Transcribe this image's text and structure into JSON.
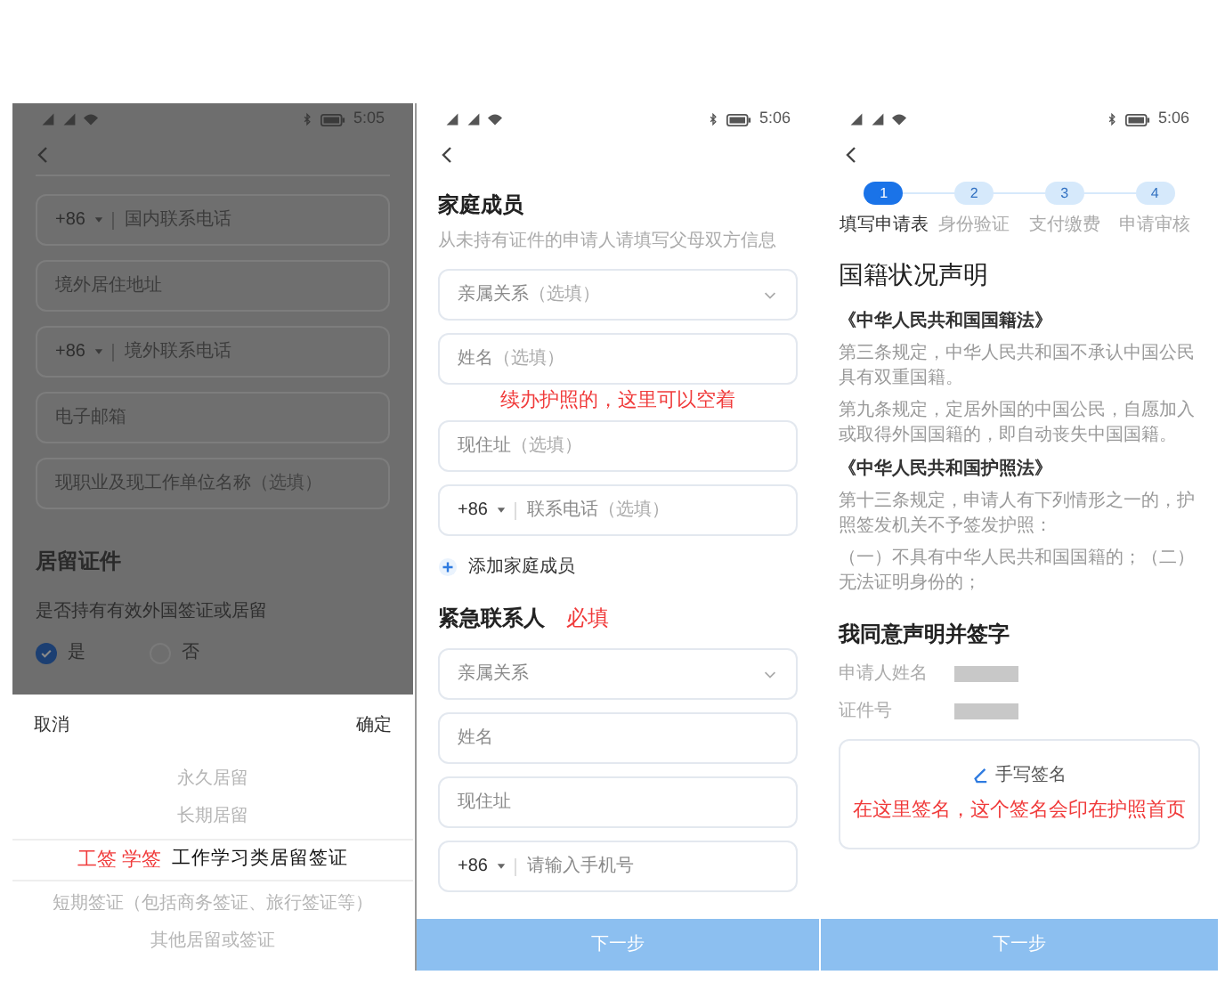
{
  "left_screen": {
    "status_time": "5:05",
    "fields": [
      {
        "kind": "phone",
        "code": "+86",
        "placeholder": "国内联系电话"
      },
      {
        "kind": "text",
        "placeholder": "境外居住地址"
      },
      {
        "kind": "phone",
        "code": "+86",
        "placeholder": "境外联系电话"
      },
      {
        "kind": "text",
        "placeholder": "电子邮箱"
      },
      {
        "kind": "text",
        "placeholder": "现职业及现工作单位名称",
        "note": "（选填）"
      }
    ],
    "section_title": "居留证件",
    "question": "是否持有有效外国签证或居留",
    "options": [
      {
        "label": "是",
        "selected": true
      },
      {
        "label": "否",
        "selected": false
      }
    ],
    "picker": {
      "cancel": "取消",
      "confirm": "确定",
      "annotation": "工签 学签",
      "items": [
        {
          "label": "永久居留",
          "selected": false
        },
        {
          "label": "长期居留",
          "selected": false
        },
        {
          "label": "工作学习类居留签证",
          "selected": true
        },
        {
          "label": "短期签证（包括商务签证、旅行签证等）",
          "selected": false
        },
        {
          "label": "其他居留或签证",
          "selected": false
        }
      ]
    }
  },
  "middle_screen": {
    "status_time": "5:06",
    "title": "家庭成员",
    "subtitle": "从未持有证件的申请人请填写父母双方信息",
    "family_fields": [
      {
        "kind": "select",
        "placeholder": "亲属关系",
        "note": "（选填）"
      },
      {
        "kind": "text",
        "placeholder": "姓名",
        "note": "（选填）"
      },
      {
        "kind": "text",
        "placeholder": "现住址",
        "note": "（选填）"
      },
      {
        "kind": "phone",
        "code": "+86",
        "placeholder": "联系电话",
        "note": "（选填）"
      }
    ],
    "annotation": "续办护照的，这里可以空着",
    "add_button": "添加家庭成员",
    "emergency_title": "紧急联系人",
    "required_note": "必填",
    "emergency_fields": [
      {
        "kind": "select",
        "placeholder": "亲属关系"
      },
      {
        "kind": "text",
        "placeholder": "姓名"
      },
      {
        "kind": "text",
        "placeholder": "现住址"
      },
      {
        "kind": "phone",
        "code": "+86",
        "placeholder": "请输入手机号"
      }
    ],
    "next_button": "下一步"
  },
  "right_screen": {
    "status_time": "5:06",
    "steps": [
      {
        "number": "1",
        "label": "填写申请表",
        "selected": true
      },
      {
        "number": "2",
        "label": "身份验证",
        "selected": false
      },
      {
        "number": "3",
        "label": "支付缴费",
        "selected": false
      },
      {
        "number": "4",
        "label": "申请审核",
        "selected": false
      }
    ],
    "title": "国籍状况声明",
    "paragraphs": [
      {
        "kind": "law",
        "text": "《中华人民共和国国籍法》"
      },
      {
        "kind": "text",
        "text": "第三条规定，中华人民共和国不承认中国公民具有双重国籍。"
      },
      {
        "kind": "text",
        "text": "第九条规定，定居外国的中国公民，自愿加入或取得外国国籍的，即自动丧失中国国籍。"
      },
      {
        "kind": "law",
        "text": "《中华人民共和国护照法》"
      },
      {
        "kind": "text",
        "text": "第十三条规定，申请人有下列情形之一的，护照签发机关不予签发护照："
      },
      {
        "kind": "text",
        "text": "（一）不具有中华人民共和国国籍的；（二）无法证明身份的；"
      }
    ],
    "declaration_title": "我同意声明并签字",
    "info_rows": [
      {
        "label": "申请人姓名"
      },
      {
        "label": "证件号"
      }
    ],
    "signature_label": "手写签名",
    "annotation": "在这里签名，这个签名会印在护照首页",
    "next_button": "下一步"
  }
}
